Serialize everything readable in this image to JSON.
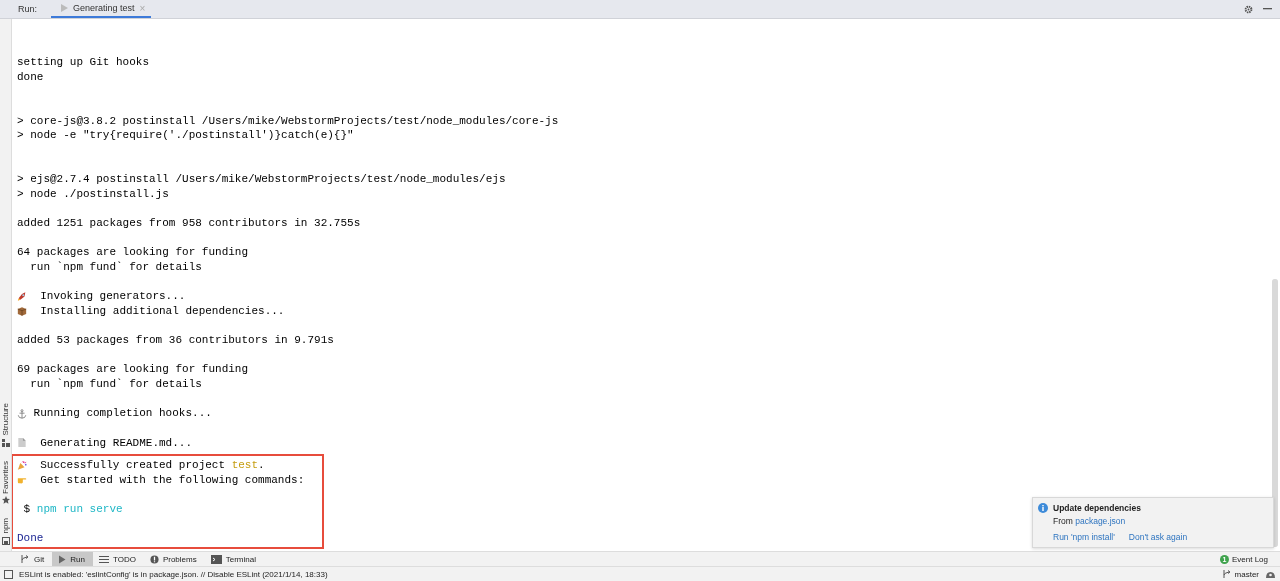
{
  "run_bar": {
    "label": "Run:",
    "tabs": [
      {
        "label": "Generating test",
        "selected": true
      }
    ],
    "close": "×"
  },
  "side_tools": [
    {
      "label": "Structure",
      "kind": "structure"
    },
    {
      "label": "Favorites",
      "kind": "star"
    },
    {
      "label": "npm",
      "kind": "npm"
    }
  ],
  "console": {
    "lines": [
      {
        "kind": "text",
        "text": "setting up Git hooks"
      },
      {
        "kind": "text",
        "text": "done"
      },
      {
        "kind": "blank"
      },
      {
        "kind": "blank"
      },
      {
        "kind": "text",
        "text": "> core-js@3.8.2 postinstall /Users/mike/WebstormProjects/test/node_modules/core-js"
      },
      {
        "kind": "text",
        "text": "> node -e \"try{require('./postinstall')}catch(e){}\""
      },
      {
        "kind": "blank"
      },
      {
        "kind": "blank"
      },
      {
        "kind": "text",
        "text": "> ejs@2.7.4 postinstall /Users/mike/WebstormProjects/test/node_modules/ejs"
      },
      {
        "kind": "text",
        "text": "> node ./postinstall.js"
      },
      {
        "kind": "blank"
      },
      {
        "kind": "text",
        "text": "added 1251 packages from 958 contributors in 32.755s"
      },
      {
        "kind": "blank"
      },
      {
        "kind": "text",
        "text": "64 packages are looking for funding"
      },
      {
        "kind": "text",
        "text": "  run `npm fund` for details"
      },
      {
        "kind": "blank"
      },
      {
        "kind": "rocket",
        "text": "  Invoking generators..."
      },
      {
        "kind": "box",
        "text": "  Installing additional dependencies..."
      },
      {
        "kind": "blank"
      },
      {
        "kind": "text",
        "text": "added 53 packages from 36 contributors in 9.791s"
      },
      {
        "kind": "blank"
      },
      {
        "kind": "text",
        "text": "69 packages are looking for funding"
      },
      {
        "kind": "text",
        "text": "  run `npm fund` for details"
      },
      {
        "kind": "blank"
      },
      {
        "kind": "anchor",
        "text": "Running completion hooks..."
      },
      {
        "kind": "blank"
      },
      {
        "kind": "file",
        "text": "  Generating README.md..."
      },
      {
        "kind": "blank"
      }
    ],
    "highlighted_lines": [
      {
        "kind": "party",
        "text": "  Successfully created project ",
        "highlight": "test",
        "tail": "."
      },
      {
        "kind": "hand",
        "text": "  Get started with the following commands:"
      },
      {
        "kind": "blank"
      },
      {
        "kind": "command",
        "prompt": " $",
        "text": "npm run serve"
      },
      {
        "kind": "blank"
      },
      {
        "kind": "done",
        "text": "Done"
      }
    ]
  },
  "notification": {
    "title": "Update dependencies",
    "body": "From ",
    "link": "package.json",
    "actions": [
      "Run 'npm install'",
      "Don't ask again"
    ]
  },
  "tool_windows": [
    {
      "label": "Git",
      "kind": "git",
      "selected": false
    },
    {
      "label": "Run",
      "kind": "run",
      "selected": true
    },
    {
      "label": "TODO",
      "kind": "todo",
      "selected": false
    },
    {
      "label": "Problems",
      "kind": "problems",
      "selected": false
    },
    {
      "label": "Terminal",
      "kind": "terminal",
      "selected": false
    }
  ],
  "event_log": {
    "label": "Event Log",
    "count": "1"
  },
  "status_bar": {
    "message": "ESLint is enabled: 'eslintConfig' is in package.json. // Disable ESLint (2021/1/14, 18:33)",
    "branch": "master"
  }
}
